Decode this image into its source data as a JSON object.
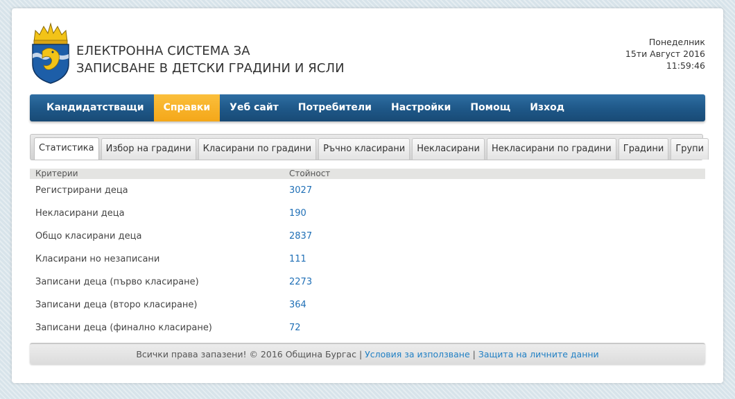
{
  "header": {
    "title_line1": "ЕЛЕКТРОННА СИСТЕМА ЗА",
    "title_line2": "ЗАПИСВАНЕ В ДЕТСКИ ГРАДИНИ И ЯСЛИ",
    "logo_icon": "burgas-coat-of-arms",
    "day": "Понеделник",
    "date": "15ти Август 2016",
    "time": "11:59:46"
  },
  "nav": {
    "items": [
      {
        "label": "Кандидатстващи"
      },
      {
        "label": "Справки",
        "active": true
      },
      {
        "label": "Уеб сайт"
      },
      {
        "label": "Потребители"
      },
      {
        "label": "Настройки"
      },
      {
        "label": "Помощ"
      },
      {
        "label": "Изход"
      }
    ]
  },
  "tabs": {
    "items": [
      {
        "label": "Статистика",
        "active": true
      },
      {
        "label": "Избор на градини"
      },
      {
        "label": "Класирани по градини"
      },
      {
        "label": "Ръчно класирани"
      },
      {
        "label": "Некласирани"
      },
      {
        "label": "Некласирани по градини"
      },
      {
        "label": "Градини"
      },
      {
        "label": "Групи"
      }
    ]
  },
  "table": {
    "headers": {
      "criteria": "Критерии",
      "value": "Стойност"
    },
    "rows": [
      {
        "criteria": "Регистрирани деца",
        "value": "3027"
      },
      {
        "criteria": "Некласирани деца",
        "value": "190"
      },
      {
        "criteria": "Общо класирани деца",
        "value": "2837"
      },
      {
        "criteria": "Класирани но незаписани",
        "value": "111"
      },
      {
        "criteria": "Записани деца (първо класиране)",
        "value": "2273"
      },
      {
        "criteria": "Записани деца (второ класиране)",
        "value": "364"
      },
      {
        "criteria": "Записани деца (финално класиране)",
        "value": "72"
      }
    ]
  },
  "footer": {
    "copyright": "Всички права запазени! © 2016 Община Бургас",
    "separator": "|",
    "terms_link": "Условия за използване",
    "privacy_link": "Защита на личните данни"
  },
  "colors": {
    "nav_blue": "#1e5787",
    "nav_active": "#f4a719",
    "value_blue": "#1f6fb6",
    "link_blue": "#1f7fc4"
  }
}
